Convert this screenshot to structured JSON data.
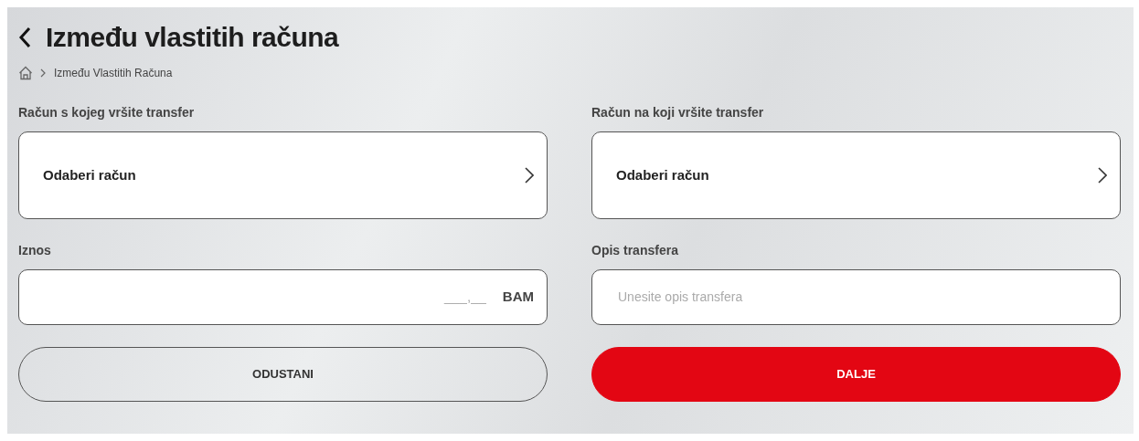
{
  "header": {
    "title": "Između vlastitih računa"
  },
  "breadcrumb": [
    {
      "label": "Između Vlastitih Računa"
    }
  ],
  "fields": [
    {
      "kind": "select",
      "label": "Račun s kojeg vršite transfer",
      "value": "Odaberi račun"
    },
    {
      "kind": "select",
      "label": "Račun na koji vršite transfer",
      "value": "Odaberi račun"
    },
    {
      "kind": "amount",
      "label": "Iznos",
      "placeholder": "___,__",
      "currency": "BAM"
    },
    {
      "kind": "text",
      "label": "Opis transfera",
      "placeholder": "Unesite opis transfera"
    }
  ],
  "buttons": [
    {
      "label": "ODUSTANI",
      "kind": "secondary"
    },
    {
      "label": "DALJE",
      "kind": "primary"
    }
  ]
}
